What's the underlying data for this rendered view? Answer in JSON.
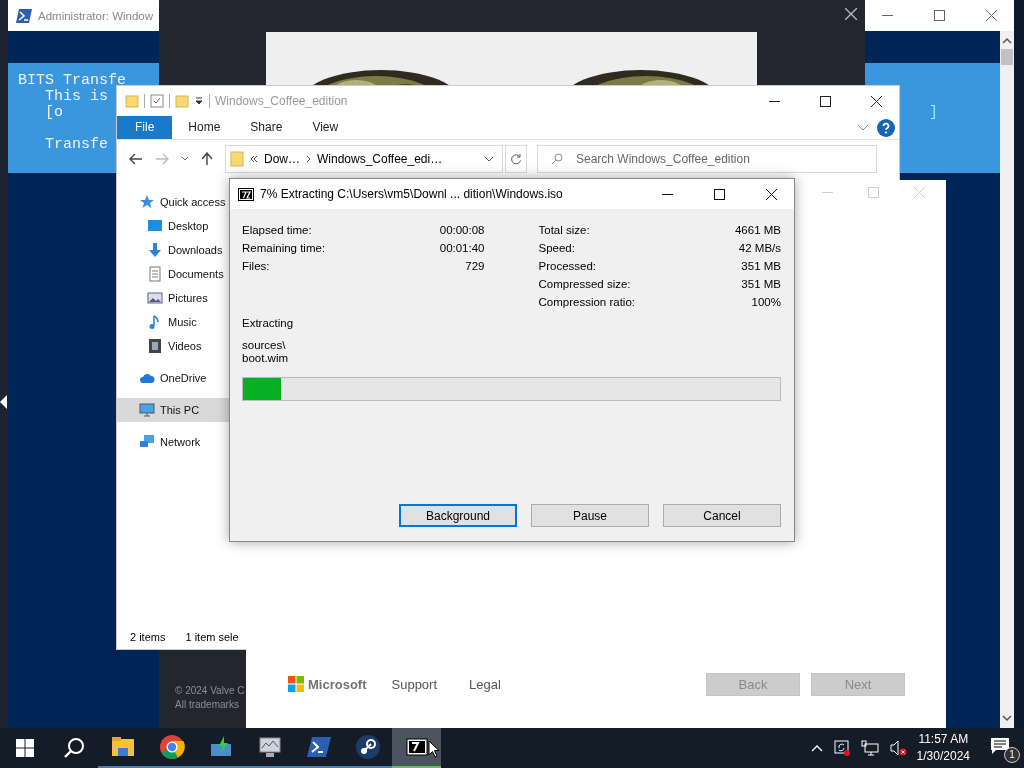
{
  "powershell": {
    "title": "Administrator: Window",
    "lines": [
      "BITS Transfe",
      "   This is",
      "   [o",
      "   Transfe"
    ],
    "bracket": "]"
  },
  "steam": {
    "picture": {
      "kind": "picture"
    },
    "footer": [
      "© 2024 Valve C",
      "All trademarks"
    ]
  },
  "explorer": {
    "title": "Windows_Coffee_edition",
    "tabs": [
      {
        "label": "File",
        "selected": true
      },
      {
        "label": "Home",
        "selected": false
      },
      {
        "label": "Share",
        "selected": false
      },
      {
        "label": "View",
        "selected": false
      }
    ],
    "path": [
      "Dow…",
      "Windows_Coffee_edi…"
    ],
    "search": {
      "placeholder": "Search Windows_Coffee_edition"
    },
    "nav": [
      {
        "label": "Quick access",
        "kind": "star",
        "selected": false,
        "group": true
      },
      {
        "label": "Desktop",
        "kind": "desktop",
        "selected": false,
        "group": false
      },
      {
        "label": "Downloads",
        "kind": "download",
        "selected": false,
        "group": false
      },
      {
        "label": "Documents",
        "kind": "document",
        "selected": false,
        "group": false
      },
      {
        "label": "Pictures",
        "kind": "pictures",
        "selected": false,
        "group": false
      },
      {
        "label": "Music",
        "kind": "music",
        "selected": false,
        "group": false
      },
      {
        "label": "Videos",
        "kind": "videos",
        "selected": false,
        "group": false
      },
      {
        "label": "OneDrive",
        "kind": "cloud",
        "selected": false,
        "group": true
      },
      {
        "label": "This PC",
        "kind": "pc",
        "selected": true,
        "group": true
      },
      {
        "label": "Network",
        "kind": "network",
        "selected": false,
        "group": true
      }
    ],
    "status": [
      "2 items",
      "1 item sele"
    ]
  },
  "setup": {
    "brand": "Microsoft",
    "links": [
      "Support",
      "Legal"
    ],
    "buttons": [
      {
        "label": "Back",
        "disabled": true
      },
      {
        "label": "Next",
        "disabled": true
      }
    ]
  },
  "extract": {
    "title": "7% Extracting C:\\Users\\vm5\\Downl ... dition\\Windows.iso",
    "left": [
      {
        "label": "Elapsed time:",
        "value": "00:00:08"
      },
      {
        "label": "Remaining time:",
        "value": "00:01:40"
      },
      {
        "label": "Files:",
        "value": "729"
      }
    ],
    "right": [
      {
        "label": "Total size:",
        "value": "4661 MB"
      },
      {
        "label": "Speed:",
        "value": "42 MB/s"
      },
      {
        "label": "Processed:",
        "value": "351 MB"
      },
      {
        "label": "Compressed size:",
        "value": "351 MB"
      },
      {
        "label": "Compression ratio:",
        "value": "100%"
      }
    ],
    "action": "Extracting",
    "file": [
      "sources\\",
      "boot.wim"
    ],
    "progress": {
      "level": 0.07
    },
    "buttons": [
      {
        "label": "Background",
        "selected": true
      },
      {
        "label": "Pause",
        "selected": false
      },
      {
        "label": "Cancel",
        "selected": false
      }
    ]
  },
  "taskbar": {
    "apps": [
      {
        "kind": "folder",
        "running": true,
        "selected": false
      },
      {
        "kind": "chrome",
        "running": true,
        "selected": false
      },
      {
        "kind": "installer",
        "running": true,
        "selected": false
      },
      {
        "kind": "monitor",
        "running": true,
        "selected": false
      },
      {
        "kind": "powershell",
        "running": true,
        "selected": false
      },
      {
        "kind": "steam",
        "running": true,
        "selected": false
      },
      {
        "kind": "sevenzip",
        "running": true,
        "selected": true
      }
    ],
    "time": "11:57 AM",
    "date": "1/30/2024",
    "notifications": "1"
  }
}
